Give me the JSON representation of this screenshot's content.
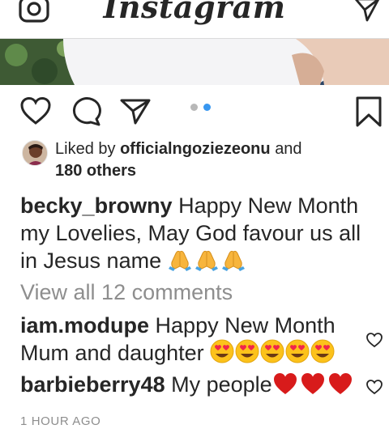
{
  "header": {
    "logo_text": "Instagram",
    "camera_icon": "camera-icon",
    "direct_icon": "paper-plane-icon"
  },
  "post": {
    "carousel": {
      "total": 2,
      "active_index": 1,
      "active_color": "#3897f0",
      "inactive_color": "#b8b8b8"
    },
    "actions": {
      "like_icon": "heart-outline-icon",
      "comment_icon": "comment-bubble-icon",
      "share_icon": "paper-plane-icon",
      "save_icon": "bookmark-icon"
    },
    "likes": {
      "prefix": "Liked by",
      "liker": "officialngoziezeonu",
      "connector": "and",
      "others": "180 others"
    },
    "caption": {
      "username": "becky_browny",
      "text": "Happy New Month my Lovelies, May God favour us all in Jesus name",
      "emoji": "🙏🙏🙏"
    },
    "view_all_comments": "View all 12 comments",
    "comments": [
      {
        "username": "iam.modupe",
        "text": "Happy New Month Mum and daughter",
        "emoji": "😍😍😍😍😍"
      },
      {
        "username": "barbieberry48",
        "text": "My people",
        "emoji": "❤️❤️❤️"
      }
    ],
    "timestamp": "1 HOUR AGO"
  }
}
